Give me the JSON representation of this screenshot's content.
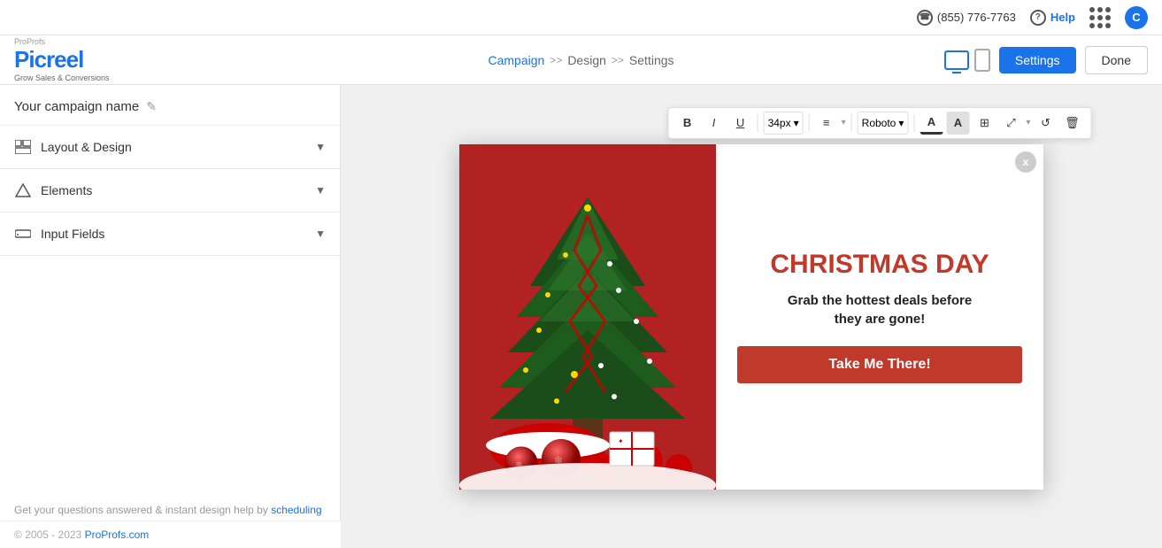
{
  "topbar": {
    "phone": "(855) 776-7763",
    "help": "Help",
    "avatar_letter": "C"
  },
  "header": {
    "logo_proprofs": "ProProfs",
    "logo_picreel": "Picreel",
    "logo_tagline": "Grow Sales & Conversions",
    "nav": {
      "campaign": "Campaign",
      "sep1": ">>",
      "design": "Design",
      "sep2": ">>",
      "settings": "Settings"
    },
    "btn_settings": "Settings",
    "btn_done": "Done"
  },
  "sidebar": {
    "campaign_name": "Your campaign name",
    "edit_icon": "✎",
    "sections": [
      {
        "id": "layout",
        "label": "Layout & Design",
        "icon": "layout"
      },
      {
        "id": "elements",
        "label": "Elements",
        "icon": "elements"
      },
      {
        "id": "input_fields",
        "label": "Input Fields",
        "icon": "input"
      }
    ],
    "footer_text": "Get your questions answered & instant design help by ",
    "footer_link": "scheduling a demo.",
    "copyright": "© 2005 - 2023 ",
    "copyright_link": "ProProfs.com"
  },
  "popup": {
    "title": "CHRISTMAS DAY",
    "subtitle_line1": "Grab the hottest deals before",
    "subtitle_line2": "they are gone!",
    "cta_label": "Take Me There!",
    "close_label": "x"
  },
  "toolbar": {
    "bold": "B",
    "italic": "I",
    "underline": "U",
    "font_size": "34px",
    "align_icon": "≡",
    "font_family": "Roboto",
    "color_a": "A",
    "bg_a": "A",
    "image_icon": "⊞",
    "expand_icon": "⤢",
    "undo_icon": "↺",
    "delete_icon": "🗑"
  },
  "colors": {
    "brand_blue": "#1a73e8",
    "christmas_red": "#c0392b",
    "settings_btn_bg": "#1a73e8"
  }
}
